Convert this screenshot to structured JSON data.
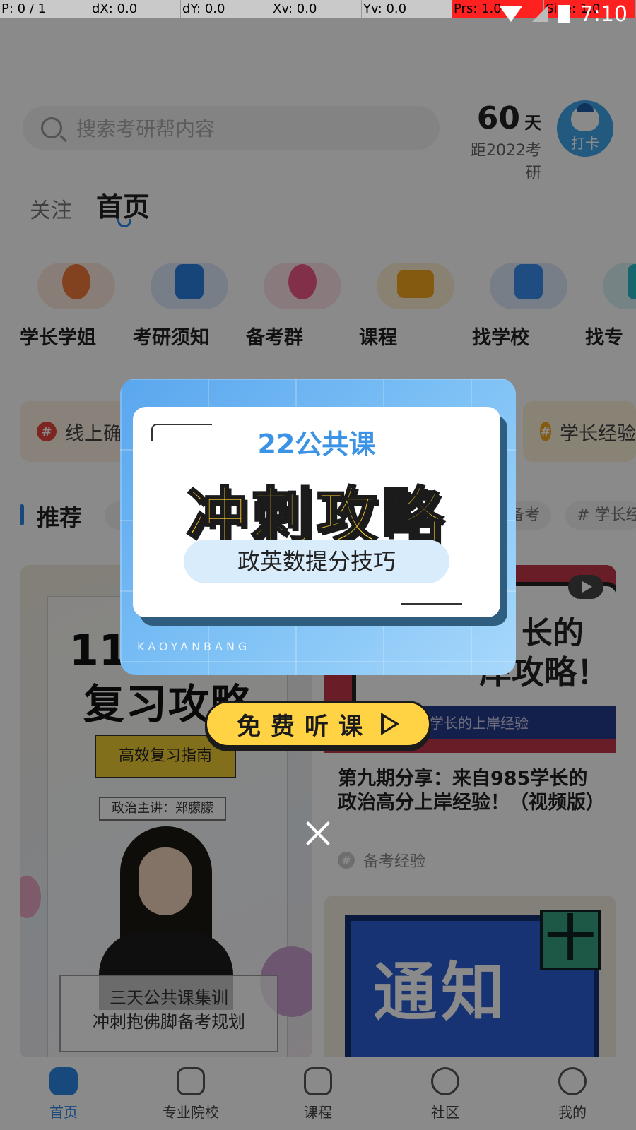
{
  "debug": {
    "p": "P: 0 / 1",
    "dx": "dX: 0.0",
    "dy": "dY: 0.0",
    "xv": "Xv: 0.0",
    "yv": "Yv: 0.0",
    "prs": "Prs: 1.0",
    "size": "Size: 1.0"
  },
  "status_bar": {
    "time": "7:10"
  },
  "header": {
    "search_placeholder": "搜索考研帮内容",
    "days_number": "60",
    "days_unit": "天",
    "days_subtitle": "距2022考研",
    "checkin_label": "打卡"
  },
  "tabs": [
    {
      "label": "关注"
    },
    {
      "label": "首页"
    }
  ],
  "categories": [
    {
      "label": "学长学姐",
      "color": "#f07a3c"
    },
    {
      "label": "考研须知",
      "color": "#2b7fe0"
    },
    {
      "label": "备考群",
      "color": "#f05a8a"
    },
    {
      "label": "课程",
      "color": "#f4a41e"
    },
    {
      "label": "找学校",
      "color": "#3a8ef0"
    },
    {
      "label": "找专",
      "color": "#2bbbc9"
    }
  ],
  "topics": [
    {
      "label": "线上确",
      "color": "#e8463e"
    },
    {
      "label": "学长经验",
      "color": "#f4a41e"
    }
  ],
  "recommend": {
    "title": "推荐",
    "tags": [
      "备考",
      "学长经验"
    ]
  },
  "cards": {
    "left": {
      "line1": "11",
      "line2": "复习攻略",
      "guide": "高效复习指南",
      "speaker": "政治主讲：郑朦朦",
      "bottom1": "三天公共课集训",
      "bottom2": "冲刺抱佛脚备考规划"
    },
    "right1": {
      "img_text1": "长的",
      "img_text2": "岸攻略！",
      "img_band": "学长的上岸经验",
      "title": "第九期分享：来自985学长的政治高分上岸经验！（视频版）",
      "tag": "备考经验"
    },
    "right2": {
      "img_text": "通知",
      "plus": "十"
    }
  },
  "nav": [
    {
      "label": "首页",
      "active": true
    },
    {
      "label": "专业院校",
      "active": false
    },
    {
      "label": "课程",
      "active": false
    },
    {
      "label": "社区",
      "active": false
    },
    {
      "label": "我的",
      "active": false
    }
  ],
  "popup": {
    "subtitle": "22公共课",
    "title": "冲刺攻略",
    "pill": "政英数提分技巧",
    "brand": "KAOYANBANG",
    "button": "免费听课"
  }
}
